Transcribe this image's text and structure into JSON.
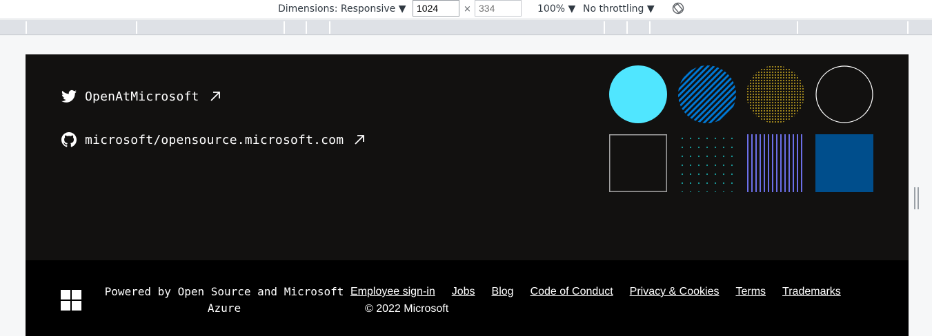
{
  "devtools": {
    "dimensions_label": "Dimensions: Responsive ▼",
    "width_value": "1024",
    "height_placeholder": "334",
    "times": "×",
    "zoom": "100% ▼",
    "throttling": "No throttling ▼"
  },
  "social": {
    "twitter": {
      "label": "OpenAtMicrosoft",
      "icon": "twitter-icon"
    },
    "github": {
      "label": "microsoft/opensource.microsoft.com",
      "icon": "github-icon"
    }
  },
  "footer": {
    "powered_line1": "Powered by Open Source and Microsoft",
    "powered_line2": "Azure",
    "nav": [
      "Employee sign-in",
      "Jobs",
      "Blog",
      "Code of Conduct",
      "Privacy & Cookies",
      "Terms",
      "Trademarks"
    ],
    "copyright": "© 2022 Microsoft"
  },
  "colors": {
    "cyan": "#50e6ff",
    "blue_stripe": "#0078d4",
    "gold_dot": "#c9a820",
    "teal_dot": "#1aa6a6",
    "purple_stripe": "#6b6fe8",
    "navy": "#004e8c",
    "page_bg": "#121110",
    "bottom_bg": "#000000"
  }
}
